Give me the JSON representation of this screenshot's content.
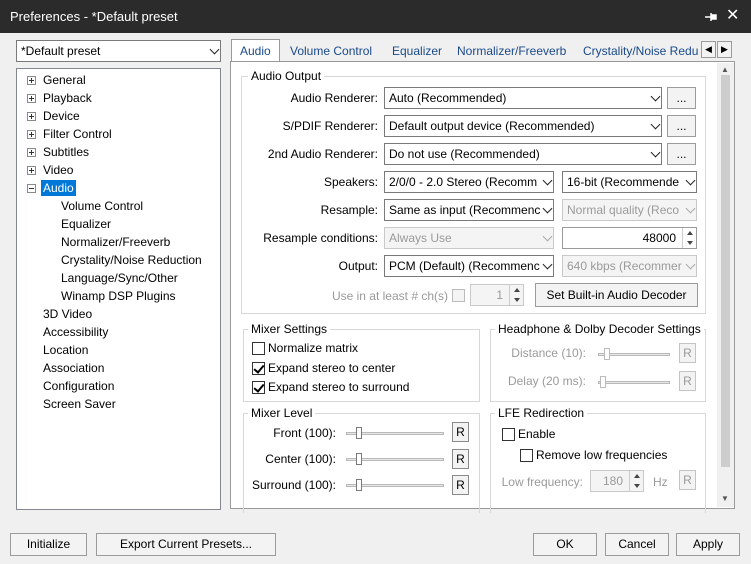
{
  "window": {
    "title": "Preferences - *Default preset"
  },
  "preset": {
    "value": "*Default preset"
  },
  "tree": {
    "items": [
      "General",
      "Playback",
      "Device",
      "Filter Control",
      "Subtitles",
      "Video",
      "Audio"
    ],
    "audio_children": [
      "Volume Control",
      "Equalizer",
      "Normalizer/Freeverb",
      "Crystality/Noise Reduction",
      "Language/Sync/Other",
      "Winamp DSP Plugins"
    ],
    "items_after": [
      "3D Video",
      "Accessibility",
      "Location",
      "Association",
      "Configuration",
      "Screen Saver"
    ],
    "selected": "Audio"
  },
  "tabs": [
    "Audio",
    "Volume Control",
    "Equalizer",
    "Normalizer/Freeverb",
    "Crystality/Noise Redu"
  ],
  "audio_output": {
    "group_title": "Audio Output",
    "renderer_label": "Audio Renderer:",
    "renderer_value": "Auto (Recommended)",
    "spdif_label": "S/PDIF Renderer:",
    "spdif_value": "Default output device (Recommended)",
    "second_label": "2nd Audio Renderer:",
    "second_value": "Do not use (Recommended)",
    "ellipsis": "...",
    "speakers_label": "Speakers:",
    "speakers_value": "2/0/0 - 2.0 Stereo (Recomm",
    "bits_value": "16-bit (Recommende",
    "resample_label": "Resample:",
    "resample_value": "Same as input (Recommenc",
    "quality_value": "Normal quality (Reco",
    "resample_cond_label": "Resample conditions:",
    "resample_cond_value": "Always Use",
    "rate_value": "48000",
    "output_label": "Output:",
    "output_value": "PCM (Default) (Recommenc",
    "bitrate_value": "640 kbps (Recommer",
    "atleast_label": "Use in at least # ch(s)",
    "atleast_value": "1",
    "builtin_button": "Set Built-in Audio Decoder"
  },
  "mixer_settings": {
    "group_title": "Mixer Settings",
    "normalize": {
      "label": "Normalize matrix",
      "checked": false
    },
    "center": {
      "label": "Expand stereo to center",
      "checked": true
    },
    "surround": {
      "label": "Expand stereo to surround",
      "checked": true
    }
  },
  "headphone": {
    "group_title": "Headphone & Dolby Decoder Settings",
    "distance_label": "Distance (10):",
    "delay_label": "Delay (20 ms):",
    "reset": "R"
  },
  "mixer_level": {
    "group_title": "Mixer Level",
    "front_label": "Front (100):",
    "center_label": "Center (100):",
    "surround_label": "Surround (100):",
    "reset": "R"
  },
  "lfe": {
    "group_title": "LFE Redirection",
    "enable_label": "Enable",
    "remove_label": "Remove low frequencies",
    "lowfreq_label": "Low frequency:",
    "lowfreq_value": "180",
    "unit": "Hz",
    "reset": "R"
  },
  "footer": {
    "initialize": "Initialize",
    "export": "Export Current Presets...",
    "ok": "OK",
    "cancel": "Cancel",
    "apply": "Apply"
  }
}
